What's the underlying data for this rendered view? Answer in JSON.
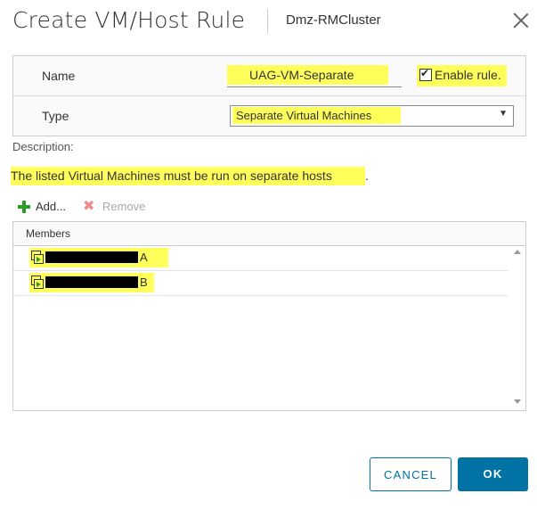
{
  "dialog": {
    "title": "Create VM/Host Rule",
    "cluster": "Dmz-RMCluster"
  },
  "form": {
    "name_label": "Name",
    "name_value": "UAG-VM-Separate",
    "enable_label": "Enable rule.",
    "enable_checked": true,
    "type_label": "Type",
    "type_value": "Separate Virtual Machines"
  },
  "description": {
    "label": "Description:",
    "text_highlighted": "The listed Virtual Machines must be run on separate hosts",
    "text_tail": "."
  },
  "toolbar": {
    "add_label": "Add...",
    "remove_label": "Remove"
  },
  "members": {
    "header": "Members",
    "rows": [
      {
        "suffix": "A"
      },
      {
        "suffix": "B"
      }
    ]
  },
  "footer": {
    "cancel_label": "CANCEL",
    "ok_label": "OK"
  },
  "colors": {
    "highlight": "#ffff5c",
    "primary": "#0072a3",
    "add_green": "#2b9b2b",
    "remove_red": "#f08a8a"
  }
}
